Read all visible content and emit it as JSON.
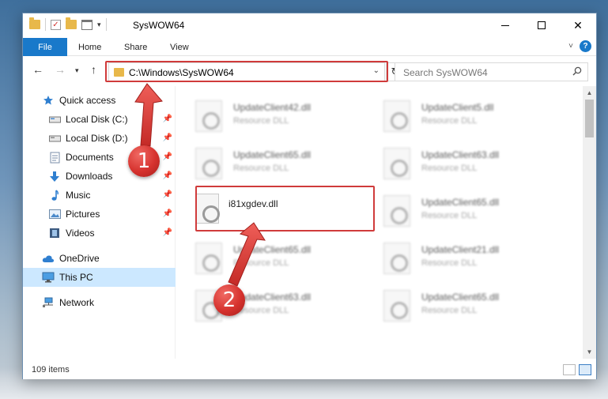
{
  "window": {
    "title": "SysWOW64",
    "caption_buttons": [
      "minimize",
      "maximize",
      "close"
    ]
  },
  "ribbon": {
    "tabs": [
      {
        "label": "File",
        "active": true
      },
      {
        "label": "Home"
      },
      {
        "label": "Share"
      },
      {
        "label": "View"
      }
    ],
    "help_label": "?"
  },
  "navigation": {
    "address": "C:\\Windows\\SysWOW64",
    "search_placeholder": "Search SysWOW64"
  },
  "sidebar": {
    "items": [
      {
        "label": "Quick access",
        "icon": "star-icon",
        "pinned": false
      },
      {
        "label": "Local Disk (C:)",
        "icon": "drive-icon",
        "pinned": true
      },
      {
        "label": "Local Disk (D:)",
        "icon": "drive-icon",
        "pinned": true
      },
      {
        "label": "Documents",
        "icon": "documents-icon",
        "pinned": true
      },
      {
        "label": "Downloads",
        "icon": "download-arrow-icon",
        "pinned": true
      },
      {
        "label": "Music",
        "icon": "music-note-icon",
        "pinned": true
      },
      {
        "label": "Pictures",
        "icon": "pictures-icon",
        "pinned": true
      },
      {
        "label": "Videos",
        "icon": "film-icon",
        "pinned": true
      },
      {
        "label": "OneDrive",
        "icon": "cloud-icon",
        "pinned": false
      },
      {
        "label": "This PC",
        "icon": "monitor-icon",
        "pinned": false,
        "selected": true
      },
      {
        "label": "Network",
        "icon": "network-icon",
        "pinned": false
      }
    ]
  },
  "files": [
    {
      "name": "UpdateClient42.dll",
      "type": "Resource DLL",
      "blurred": true
    },
    {
      "name": "UpdateClient5.dll",
      "type": "Resource DLL",
      "blurred": true
    },
    {
      "name": "UpdateClient65.dll",
      "type": "Resource DLL",
      "blurred": true
    },
    {
      "name": "UpdateClient63.dll",
      "type": "Resource DLL",
      "blurred": true
    },
    {
      "name": "i81xgdev.dll",
      "type": "",
      "blurred": false
    },
    {
      "name": "UpdateClient65.dll",
      "type": "Resource DLL",
      "blurred": true
    },
    {
      "name": "UpdateClient65.dll",
      "type": "Resource DLL",
      "blurred": true
    },
    {
      "name": "UpdateClient21.dll",
      "type": "Resource DLL",
      "blurred": true
    },
    {
      "name": "UpdateClient63.dll",
      "type": "Resource DLL",
      "blurred": true
    },
    {
      "name": "UpdateClient65.dll",
      "type": "Resource DLL",
      "blurred": true
    }
  ],
  "status": {
    "item_count": "109 items"
  },
  "annotations": {
    "step1": "1",
    "step2": "2",
    "color": "#d03b3b"
  },
  "colors": {
    "accent": "#1979ca",
    "selection": "#cce8ff",
    "folder": "#e8b84a"
  }
}
